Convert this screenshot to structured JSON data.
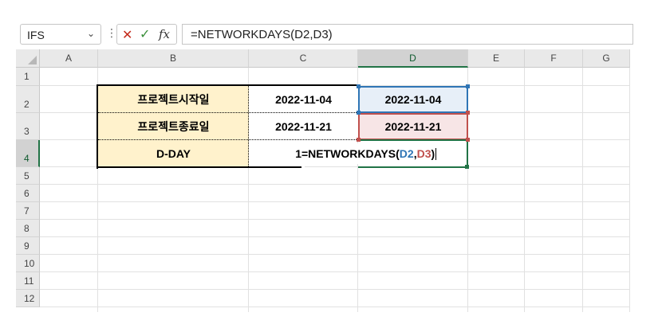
{
  "formula_bar": {
    "name_box": "IFS",
    "name_box_icon": "chevron-down-icon",
    "more_icon": "vertical-dots-icon",
    "cancel_icon": "close-icon",
    "enter_icon": "checkmark-icon",
    "fx_label": "fx",
    "formula": "=NETWORKDAYS(D2,D3)"
  },
  "columns": [
    "A",
    "B",
    "C",
    "D",
    "E",
    "F",
    "G"
  ],
  "selected_column": "D",
  "rows": [
    "1",
    "2",
    "3",
    "4",
    "5",
    "6",
    "7",
    "8",
    "9",
    "10",
    "11",
    "12"
  ],
  "selected_row": "4",
  "table": {
    "b2": "프로젝트시작일",
    "c2": "2022-11-04",
    "d2": "2022-11-04",
    "b3": "프로젝트종료일",
    "c3": "2022-11-21",
    "d3": "2022-11-21",
    "b4": "D-DAY",
    "c4_truncated": "1",
    "edit": {
      "prefix": "=NETWORKDAYS(",
      "ref1": "D2",
      "comma": ",",
      "ref2": "D3",
      "suffix": ")"
    }
  },
  "colors": {
    "label_fill": "#fff2cc",
    "ref1_color": "#2f75b5",
    "ref2_color": "#c0504d",
    "excel_green": "#217346"
  }
}
